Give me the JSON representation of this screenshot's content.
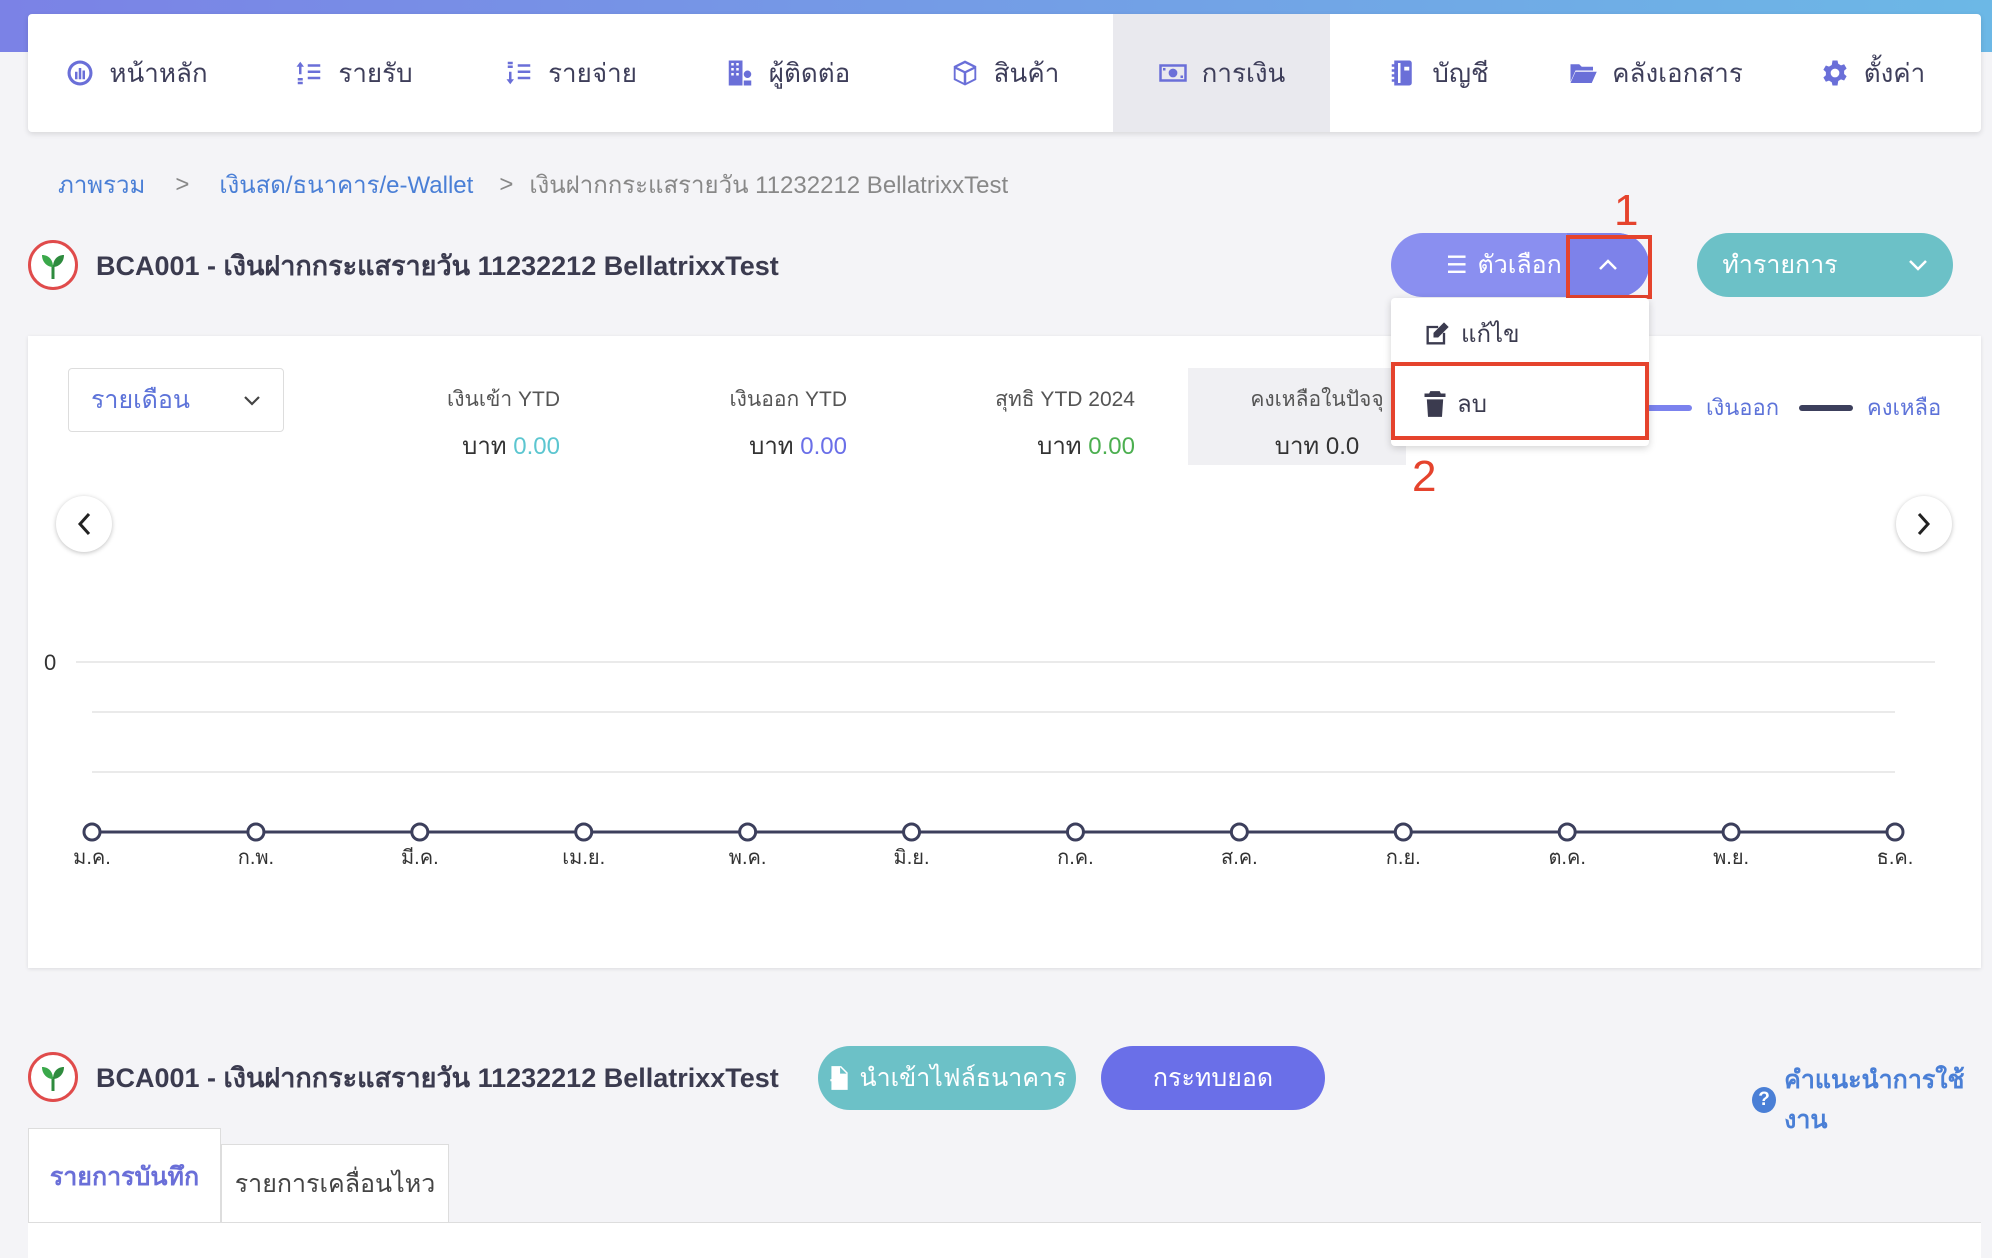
{
  "nav": {
    "items": [
      {
        "label": "หน้าหลัก",
        "icon": "dashboard-icon"
      },
      {
        "label": "รายรับ",
        "icon": "income-icon"
      },
      {
        "label": "รายจ่าย",
        "icon": "expense-icon"
      },
      {
        "label": "ผู้ติดต่อ",
        "icon": "contacts-icon"
      },
      {
        "label": "สินค้า",
        "icon": "product-box-icon"
      },
      {
        "label": "การเงิน",
        "icon": "money-icon",
        "active": true
      },
      {
        "label": "บัญชี",
        "icon": "ledger-book-icon"
      },
      {
        "label": "คลังเอกสาร",
        "icon": "folder-icon"
      },
      {
        "label": "ตั้งค่า",
        "icon": "gear-icon"
      }
    ]
  },
  "breadcrumb": {
    "home": "ภาพรวม",
    "section": "เงินสด/ธนาคาร/e-Wallet",
    "current": "เงินฝากกระแสรายวัน 11232212 BellatrixxTest",
    "separator": ">"
  },
  "account": {
    "title": "BCA001 - เงินฝากกระแสรายวัน 11232212 BellatrixxTest"
  },
  "actions": {
    "options_label": "ตัวเลือก",
    "transact_label": "ทำรายการ",
    "dropdown": {
      "edit": "แก้ไข",
      "delete": "ลบ"
    }
  },
  "annotations": {
    "step1": "1",
    "step2": "2",
    "color": "#e5432d"
  },
  "summary": {
    "period": "รายเดือน",
    "stats": [
      {
        "label": "เงินเข้า YTD",
        "currency": "บาท",
        "value": "0.00",
        "color": "#5cc6d0"
      },
      {
        "label": "เงินออก YTD",
        "currency": "บาท",
        "value": "0.00",
        "color": "#6a6fe8"
      },
      {
        "label": "สุทธิ YTD 2024",
        "currency": "บาท",
        "value": "0.00",
        "color": "#4caf50"
      },
      {
        "label": "คงเหลือในปัจจุ",
        "currency": "บาท",
        "value": "0.0",
        "color": "#333333"
      }
    ],
    "legend": [
      {
        "label": "เงินออก",
        "color": "#7b82ee"
      },
      {
        "label": "คงเหลือ",
        "color": "#3c3f5c"
      }
    ]
  },
  "chart_data": {
    "type": "line",
    "categories": [
      "ม.ค.",
      "ก.พ.",
      "มี.ค.",
      "เม.ย.",
      "พ.ค.",
      "มิ.ย.",
      "ก.ค.",
      "ส.ค.",
      "ก.ย.",
      "ต.ค.",
      "พ.ย.",
      "ธ.ค."
    ],
    "series": [
      {
        "name": "คงเหลือ",
        "values": [
          0,
          0,
          0,
          0,
          0,
          0,
          0,
          0,
          0,
          0,
          0,
          0
        ],
        "color": "#3c3f5c"
      }
    ],
    "y_tick_labels": [
      "0"
    ],
    "grid": true
  },
  "lower": {
    "account_title": "BCA001 - เงินฝากกระแสรายวัน 11232212 BellatrixxTest",
    "import_label": "นำเข้าไฟล์ธนาคาร",
    "reconcile_label": "กระทบยอด",
    "help_label": "คำแนะนำการใช้งาน",
    "tabs": [
      {
        "label": "รายการบันทึก",
        "active": true
      },
      {
        "label": "รายการเคลื่อนไหว",
        "active": false
      }
    ]
  }
}
